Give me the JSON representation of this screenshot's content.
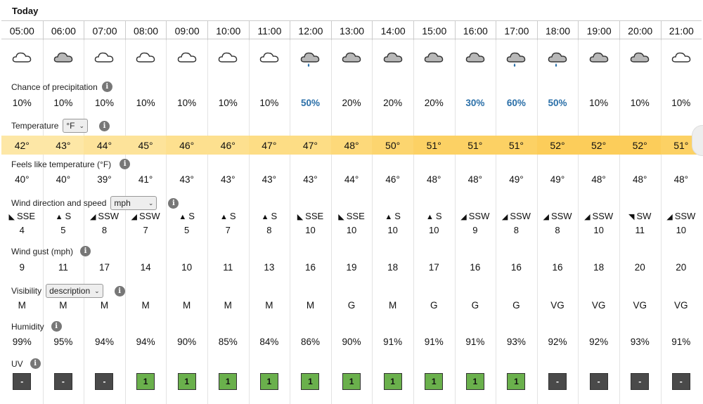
{
  "today_label": "Today",
  "hours": [
    "05:00",
    "06:00",
    "07:00",
    "08:00",
    "09:00",
    "10:00",
    "11:00",
    "12:00",
    "13:00",
    "14:00",
    "15:00",
    "16:00",
    "17:00",
    "18:00",
    "19:00",
    "20:00",
    "21:00"
  ],
  "weather_icons": [
    "cloud-outline-icon",
    "cloud-grey-icon",
    "cloud-outline-icon",
    "cloud-outline-icon",
    "cloud-outline-icon",
    "cloud-outline-icon",
    "cloud-outline-icon",
    "cloud-rain-icon",
    "cloud-grey-icon",
    "cloud-grey-icon",
    "cloud-grey-icon",
    "cloud-grey-icon",
    "cloud-rain-icon",
    "cloud-rain-icon",
    "cloud-grey-icon",
    "cloud-grey-icon",
    "cloud-outline-icon"
  ],
  "precip": {
    "label": "Chance of precipitation",
    "values": [
      "10%",
      "10%",
      "10%",
      "10%",
      "10%",
      "10%",
      "10%",
      "50%",
      "20%",
      "20%",
      "20%",
      "30%",
      "60%",
      "50%",
      "10%",
      "10%",
      "10%"
    ],
    "highlight": [
      false,
      false,
      false,
      false,
      false,
      false,
      false,
      true,
      false,
      false,
      false,
      true,
      true,
      true,
      false,
      false,
      false
    ]
  },
  "temperature": {
    "label": "Temperature",
    "unit_select": "°F",
    "values": [
      "42°",
      "43°",
      "44°",
      "45°",
      "46°",
      "46°",
      "47°",
      "47°",
      "48°",
      "50°",
      "51°",
      "51°",
      "51°",
      "52°",
      "52°",
      "52°",
      "51°"
    ],
    "colors": [
      "#fde7a6",
      "#fde7a6",
      "#fde39a",
      "#fde39a",
      "#fde08f",
      "#fde08f",
      "#fddd85",
      "#fddd85",
      "#fdd97a",
      "#fcd56f",
      "#fcd164",
      "#fcd164",
      "#fcd164",
      "#fccd5a",
      "#fccd5a",
      "#fccd5a",
      "#fcd164"
    ]
  },
  "feels_like": {
    "label": "Feels like temperature (°F)",
    "values": [
      "40°",
      "40°",
      "39°",
      "41°",
      "43°",
      "43°",
      "43°",
      "43°",
      "44°",
      "46°",
      "48°",
      "48°",
      "49°",
      "49°",
      "48°",
      "48°",
      "48°"
    ]
  },
  "wind": {
    "label": "Wind direction and speed",
    "unit_select": "mph",
    "directions": [
      "SSE",
      "S",
      "SSW",
      "SSW",
      "S",
      "S",
      "S",
      "SSE",
      "SSE",
      "S",
      "S",
      "SSW",
      "SSW",
      "SSW",
      "SSW",
      "SW",
      "SSW"
    ],
    "arrows": [
      "◣",
      "▲",
      "◢",
      "◢",
      "▲",
      "▲",
      "▲",
      "◣",
      "◣",
      "▲",
      "▲",
      "◢",
      "◢",
      "◢",
      "◢",
      "◥",
      "◢"
    ],
    "speeds": [
      "4",
      "5",
      "8",
      "7",
      "5",
      "7",
      "8",
      "10",
      "10",
      "10",
      "10",
      "9",
      "8",
      "8",
      "10",
      "11",
      "10"
    ]
  },
  "gust": {
    "label": "Wind gust (mph)",
    "values": [
      "9",
      "11",
      "17",
      "14",
      "10",
      "11",
      "13",
      "16",
      "19",
      "18",
      "17",
      "16",
      "16",
      "16",
      "18",
      "20",
      "20"
    ]
  },
  "visibility": {
    "label": "Visibility",
    "mode_select": "description",
    "values": [
      "M",
      "M",
      "M",
      "M",
      "M",
      "M",
      "M",
      "M",
      "G",
      "M",
      "G",
      "G",
      "G",
      "VG",
      "VG",
      "VG",
      "VG"
    ]
  },
  "humidity": {
    "label": "Humidity",
    "values": [
      "99%",
      "95%",
      "94%",
      "94%",
      "90%",
      "85%",
      "84%",
      "86%",
      "90%",
      "91%",
      "91%",
      "91%",
      "93%",
      "92%",
      "92%",
      "93%",
      "91%"
    ]
  },
  "uv": {
    "label": "UV",
    "values": [
      "-",
      "-",
      "-",
      "1",
      "1",
      "1",
      "1",
      "1",
      "1",
      "1",
      "1",
      "1",
      "1",
      "-",
      "-",
      "-",
      "-"
    ]
  }
}
